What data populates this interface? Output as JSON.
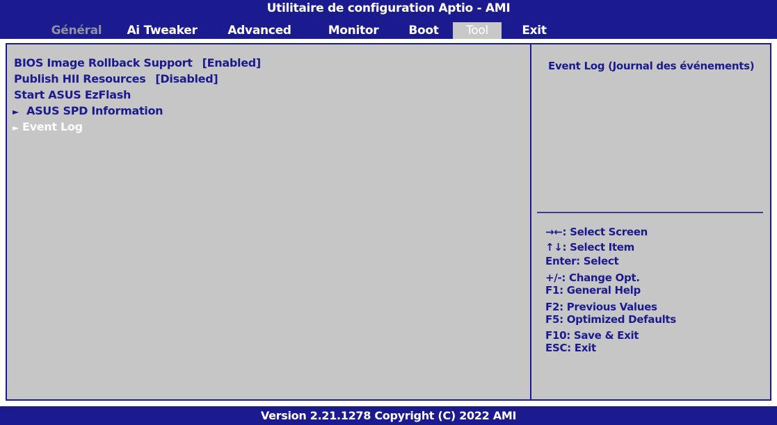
{
  "header": {
    "title": "Utilitaire de configuration Aptio - AMI",
    "tabs": [
      {
        "label": "Général",
        "state": "dim"
      },
      {
        "label": "Ai Tweaker",
        "state": "normal"
      },
      {
        "label": "Advanced",
        "state": "normal"
      },
      {
        "label": "Monitor",
        "state": "normal"
      },
      {
        "label": "Boot",
        "state": "normal"
      },
      {
        "label": "Tool",
        "state": "active"
      },
      {
        "label": "Exit",
        "state": "normal"
      }
    ]
  },
  "menu": {
    "items": [
      {
        "label": "BIOS Image Rollback Support",
        "value": "[Enabled]"
      },
      {
        "label": "Publish HII Resources",
        "value": "[Disabled]"
      },
      {
        "label": "Start ASUS EzFlash",
        "value": ""
      },
      {
        "label": "ASUS SPD Information",
        "value": "",
        "submenu_marker": "►"
      },
      {
        "label": "Event Log",
        "value": "",
        "submenu_marker": "►",
        "selected": true
      }
    ]
  },
  "help": {
    "text": "Event Log (Journal des événements)"
  },
  "keys": [
    "→←: Select Screen",
    "↑↓: Select Item",
    "Enter: Select",
    "+/-: Change Opt.",
    "F1: General Help",
    "F2: Previous Values",
    "F5: Optimized Defaults",
    "F10: Save & Exit",
    "ESC: Exit"
  ],
  "footer": {
    "text": "Version 2.21.1278 Copyright (C) 2022 AMI"
  },
  "colors": {
    "frame_blue": "#1b1b8f",
    "panel_gray": "#c6c6c6",
    "text_blue": "#1b1b8f",
    "selected_text": "#ffffff"
  }
}
